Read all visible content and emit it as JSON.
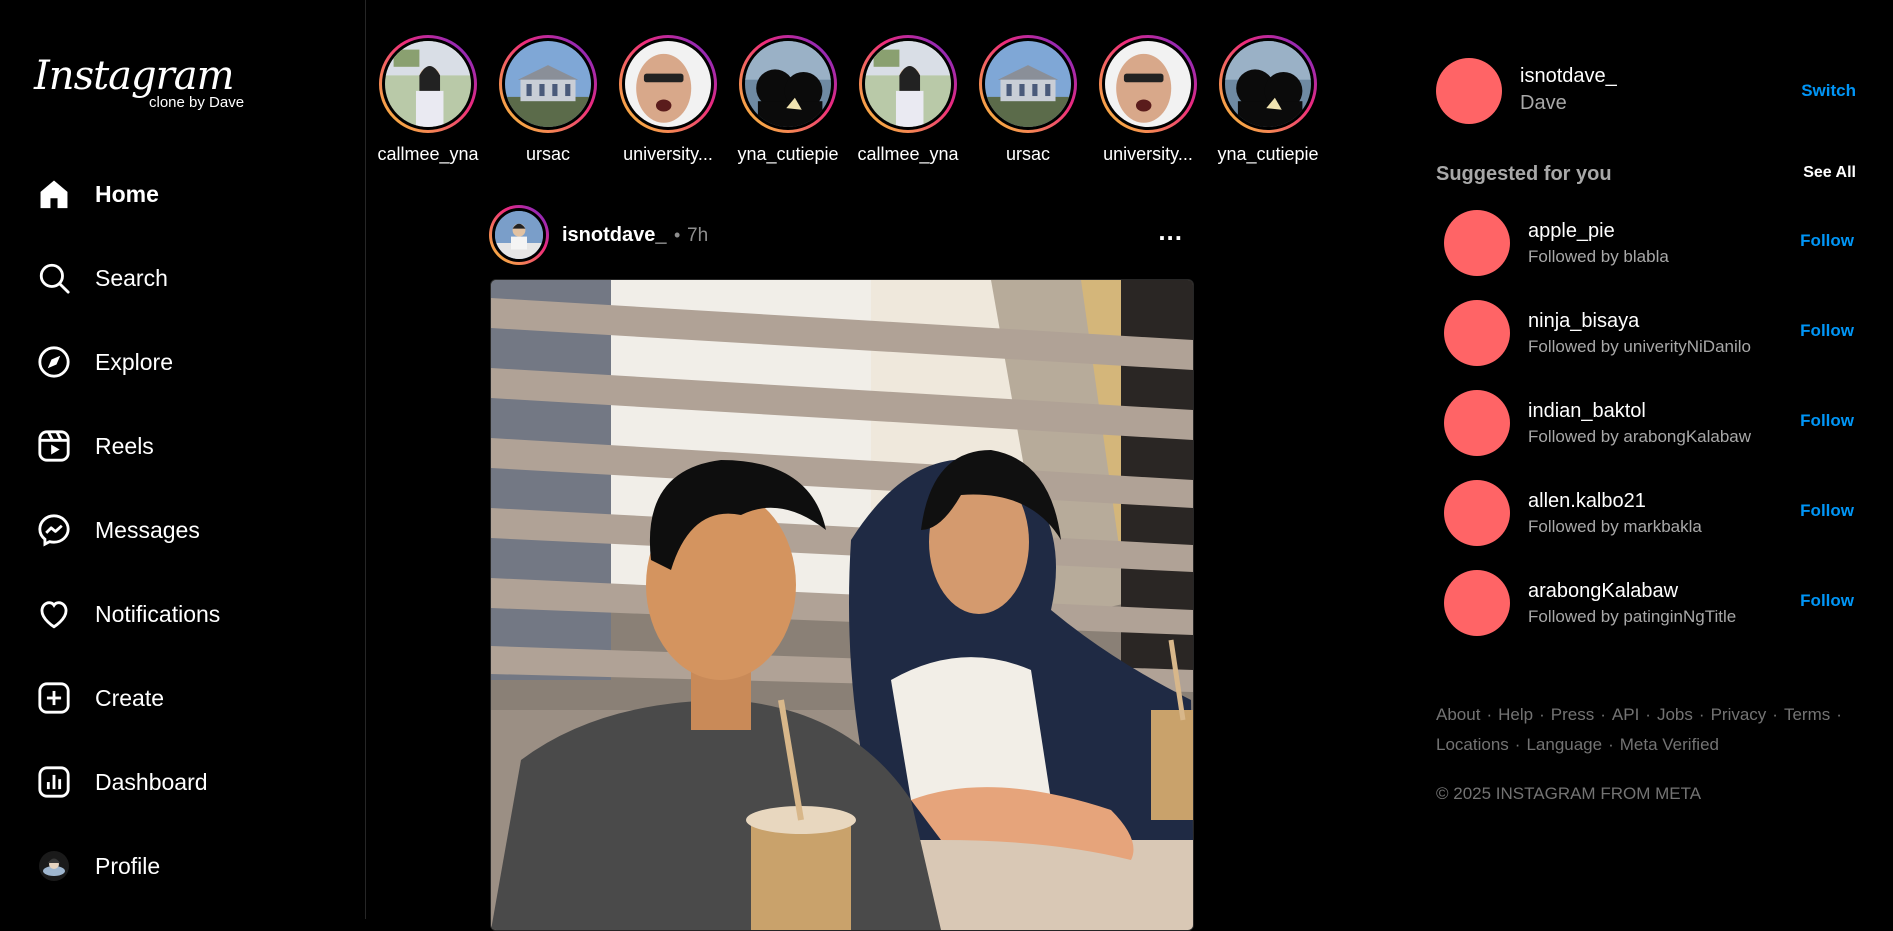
{
  "logo": {
    "main": "Instagram",
    "sub": "clone by Dave"
  },
  "nav": [
    {
      "label": "Home",
      "icon": "home-icon"
    },
    {
      "label": "Search",
      "icon": "search-icon"
    },
    {
      "label": "Explore",
      "icon": "compass-icon"
    },
    {
      "label": "Reels",
      "icon": "reels-icon"
    },
    {
      "label": "Messages",
      "icon": "messenger-icon"
    },
    {
      "label": "Notifications",
      "icon": "heart-icon"
    },
    {
      "label": "Create",
      "icon": "plus-square-icon"
    },
    {
      "label": "Dashboard",
      "icon": "dashboard-icon"
    },
    {
      "label": "Profile",
      "icon": "profile-avatar"
    }
  ],
  "stories": [
    {
      "name": "callmee_yna"
    },
    {
      "name": "ursac"
    },
    {
      "name": "university..."
    },
    {
      "name": "yna_cutiepie"
    },
    {
      "name": "callmee_yna"
    },
    {
      "name": "ursac"
    },
    {
      "name": "university..."
    },
    {
      "name": "yna_cutiepie"
    }
  ],
  "post": {
    "username": "isnotdave_",
    "separator": "•",
    "time": "7h",
    "more": "..."
  },
  "account": {
    "username": "isnotdave_",
    "name": "Dave",
    "switch_label": "Switch"
  },
  "suggestions": {
    "title": "Suggested for you",
    "see_all": "See All",
    "items": [
      {
        "username": "apple_pie",
        "subtitle": "Followed by blabla",
        "action": "Follow"
      },
      {
        "username": "ninja_bisaya",
        "subtitle": "Followed by univerityNiDanilo",
        "action": "Follow"
      },
      {
        "username": "indian_baktol",
        "subtitle": "Followed by arabongKalabaw",
        "action": "Follow"
      },
      {
        "username": "allen.kalbo21",
        "subtitle": "Followed by markbakla",
        "action": "Follow"
      },
      {
        "username": "arabongKalabaw",
        "subtitle": "Followed by patinginNgTitle",
        "action": "Follow"
      }
    ]
  },
  "footer": {
    "links_row1": [
      "About",
      "Help",
      "Press",
      "API",
      "Jobs",
      "Privacy",
      "Terms"
    ],
    "links_row2": [
      "Locations",
      "Language",
      "Meta Verified"
    ],
    "separator": "·",
    "copyright": "© 2025 INSTAGRAM FROM META"
  },
  "colors": {
    "background": "#000000",
    "accent": "#0095f6",
    "avatar_placeholder": "#ff6466",
    "muted": "#a8a8a8"
  }
}
